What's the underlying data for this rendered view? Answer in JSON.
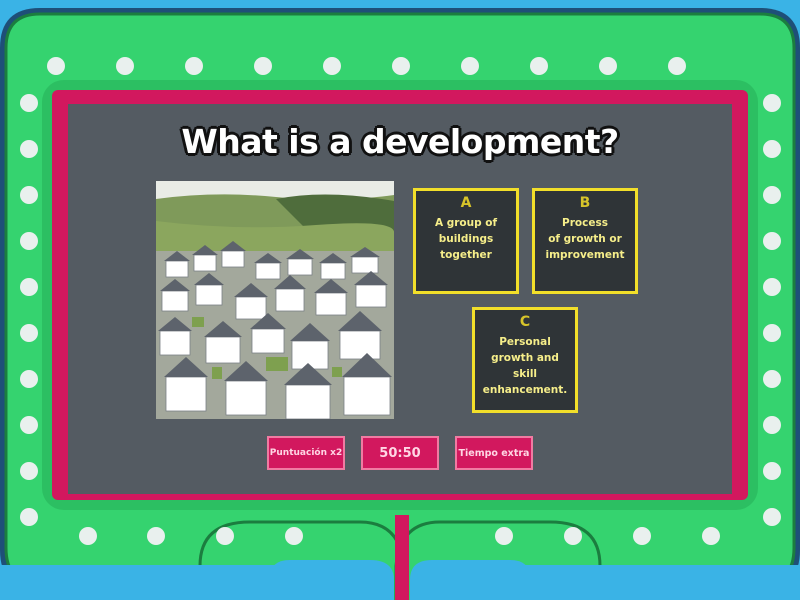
{
  "question": {
    "text": "What is a development?"
  },
  "image": {
    "icon": "housing-development-aerial-photo"
  },
  "answers": [
    {
      "letter": "A",
      "text": "A group of\nbuildings\ntogether"
    },
    {
      "letter": "B",
      "text": "Process\nof growth or\nimprovement"
    },
    {
      "letter": "C",
      "text": "Personal\ngrowth and skill\nenhancement."
    }
  ],
  "powerups": {
    "double_score": "Puntuación x2",
    "fifty_fifty": "50:50",
    "extra_time": "Tiempo extra"
  },
  "colors": {
    "background": "#3ab3e6",
    "frame_green": "#35d36f",
    "frame_dark_green": "#1f9a4b",
    "frame_magenta": "#d2185e",
    "board": "#545b62",
    "answer_border": "#f2df2a",
    "answer_fill": "#2f3437"
  }
}
